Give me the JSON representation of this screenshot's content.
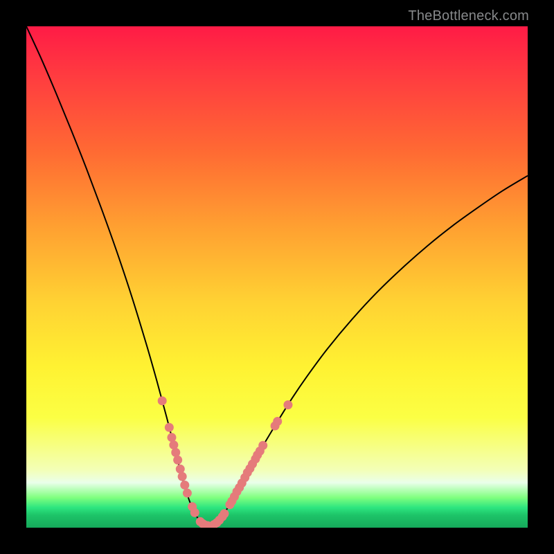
{
  "watermark": "TheBottleneck.com",
  "colors": {
    "frame": "#000000",
    "curve_stroke": "#000000",
    "dot_fill": "#e57b7b",
    "gradient_top": "#ff1b46",
    "gradient_bottom": "#16a95b"
  },
  "chart_data": {
    "type": "line",
    "title": "",
    "xlabel": "",
    "ylabel": "",
    "xlim": [
      0,
      100
    ],
    "ylim": [
      0,
      100
    ],
    "x": [
      0,
      3,
      6,
      9,
      12,
      15,
      18,
      21,
      24,
      26,
      28,
      30,
      31,
      32,
      33,
      34,
      35,
      36,
      37,
      38,
      39,
      40,
      42,
      44,
      47,
      50,
      53,
      56,
      60,
      65,
      70,
      75,
      80,
      85,
      90,
      95,
      100
    ],
    "values": [
      100,
      93.5,
      86.5,
      79.2,
      71.6,
      63.6,
      55.2,
      46.2,
      36.4,
      29.4,
      22.0,
      14.2,
      10.3,
      6.9,
      4.2,
      2.2,
      1.0,
      0.4,
      0.4,
      1.0,
      2.2,
      3.7,
      7.2,
      10.8,
      16.0,
      21.0,
      25.8,
      30.2,
      35.6,
      41.6,
      47.0,
      51.8,
      56.2,
      60.2,
      63.8,
      67.2,
      70.2
    ],
    "dots": [
      {
        "x": 27.1,
        "y": 25.3
      },
      {
        "x": 28.5,
        "y": 20.0
      },
      {
        "x": 29.0,
        "y": 18.0
      },
      {
        "x": 29.4,
        "y": 16.5
      },
      {
        "x": 29.8,
        "y": 15.0
      },
      {
        "x": 30.2,
        "y": 13.5
      },
      {
        "x": 30.7,
        "y": 11.7
      },
      {
        "x": 31.1,
        "y": 10.2
      },
      {
        "x": 31.6,
        "y": 8.5
      },
      {
        "x": 32.1,
        "y": 6.9
      },
      {
        "x": 33.1,
        "y": 4.2
      },
      {
        "x": 33.6,
        "y": 3.0
      },
      {
        "x": 34.7,
        "y": 1.2
      },
      {
        "x": 35.2,
        "y": 0.8
      },
      {
        "x": 35.7,
        "y": 0.5
      },
      {
        "x": 36.2,
        "y": 0.4
      },
      {
        "x": 37.4,
        "y": 0.6
      },
      {
        "x": 38.0,
        "y": 1.0
      },
      {
        "x": 38.5,
        "y": 1.5
      },
      {
        "x": 39.1,
        "y": 2.2
      },
      {
        "x": 39.5,
        "y": 2.8
      },
      {
        "x": 40.6,
        "y": 4.6
      },
      {
        "x": 41.0,
        "y": 5.3
      },
      {
        "x": 41.5,
        "y": 6.2
      },
      {
        "x": 42.0,
        "y": 7.2
      },
      {
        "x": 42.5,
        "y": 8.0
      },
      {
        "x": 43.0,
        "y": 8.9
      },
      {
        "x": 43.6,
        "y": 10.0
      },
      {
        "x": 44.1,
        "y": 11.0
      },
      {
        "x": 44.6,
        "y": 11.8
      },
      {
        "x": 45.1,
        "y": 12.7
      },
      {
        "x": 45.7,
        "y": 13.7
      },
      {
        "x": 46.1,
        "y": 14.5
      },
      {
        "x": 46.6,
        "y": 15.3
      },
      {
        "x": 47.2,
        "y": 16.4
      },
      {
        "x": 49.6,
        "y": 20.3
      },
      {
        "x": 50.1,
        "y": 21.2
      },
      {
        "x": 52.2,
        "y": 24.5
      }
    ]
  }
}
